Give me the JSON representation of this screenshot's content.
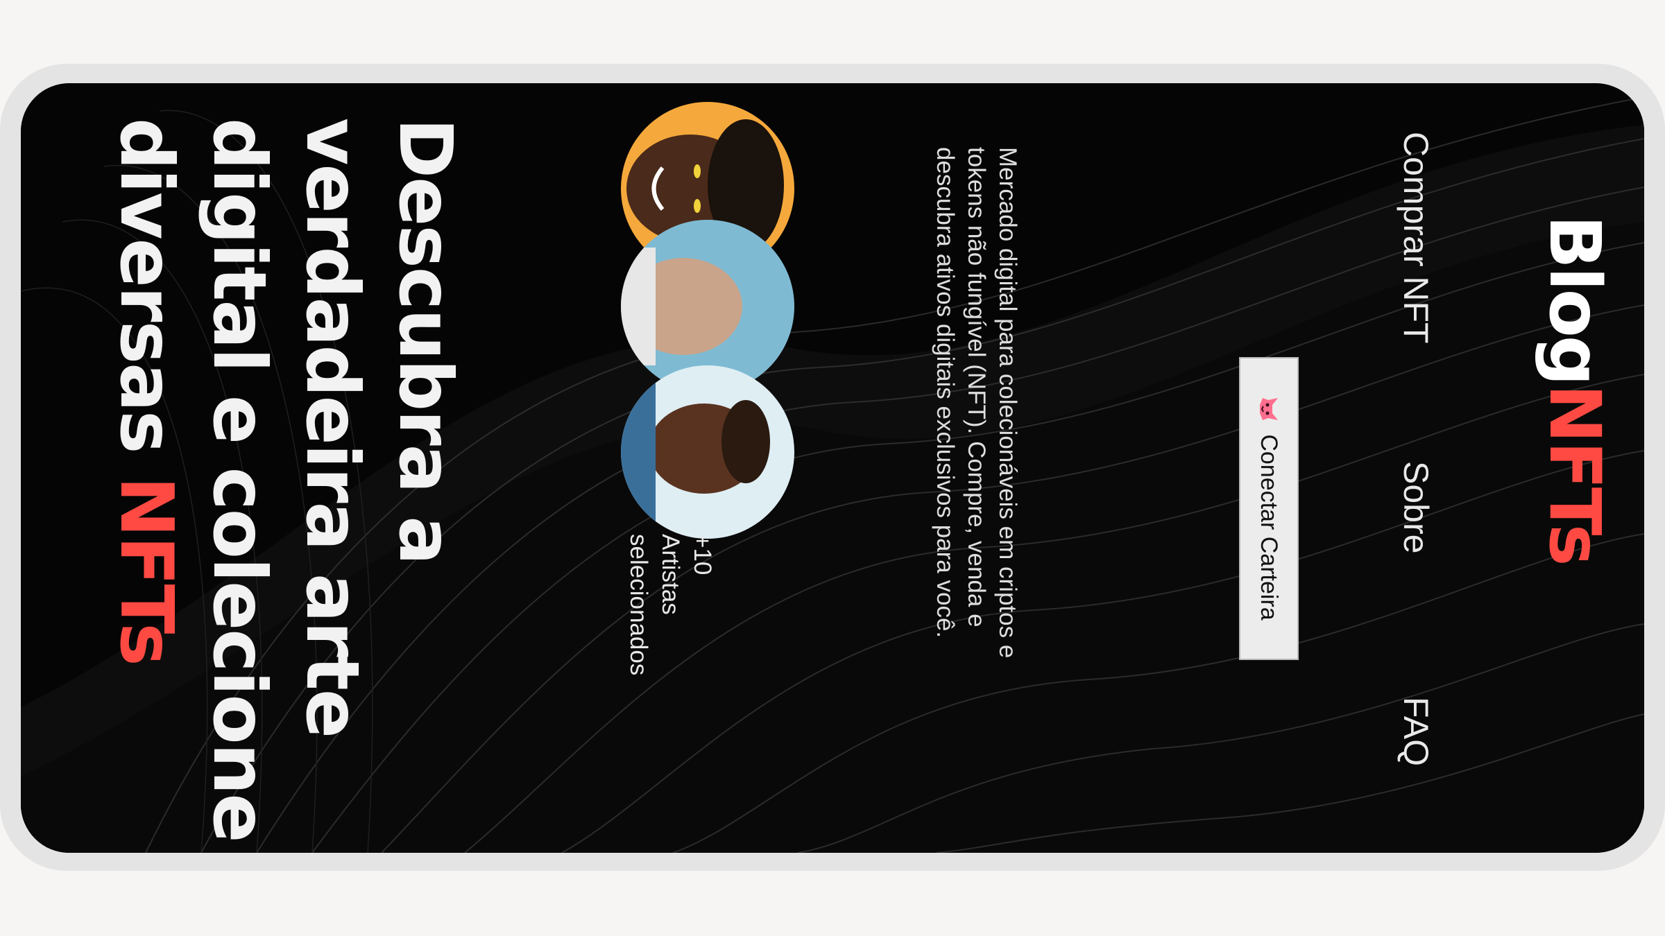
{
  "brand": {
    "logo_prefix": "Blog",
    "logo_accent": "NFTs",
    "accent_color": "#ff4a43"
  },
  "nav": {
    "items": [
      "Comprar NFT",
      "Sobre",
      "FAQ"
    ]
  },
  "wallet_button": {
    "label": "Conectar Carteira",
    "icon": "fox-icon"
  },
  "hero": {
    "description": "Mercado digital para colecionáveis em criptos e tokens não fungível (NFT). Compre, venda e descubra ativos digitais exclusivos para você.",
    "artists_count": "+10",
    "artists_label": "Artistas selecionados",
    "headline_main": "Descubra a verdadeira arte digital e colecione diversas ",
    "headline_accent": "NFTs"
  }
}
